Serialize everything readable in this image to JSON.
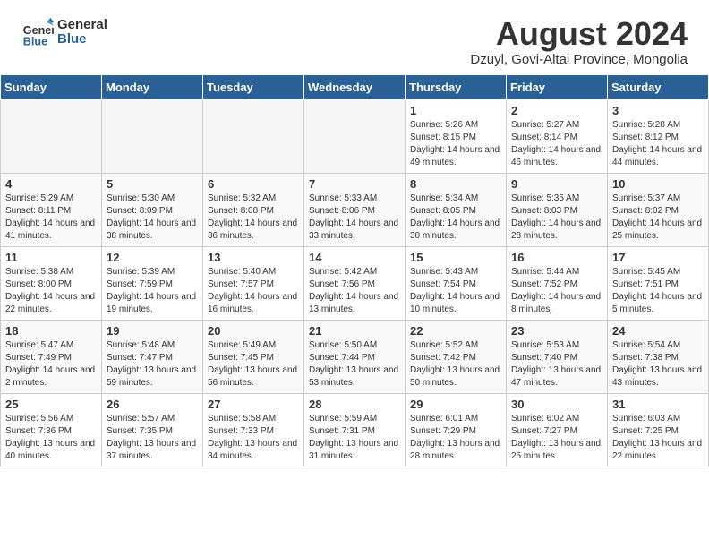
{
  "header": {
    "logo_line1": "General",
    "logo_line2": "Blue",
    "month_year": "August 2024",
    "location": "Dzuyl, Govi-Altai Province, Mongolia"
  },
  "calendar": {
    "days_of_week": [
      "Sunday",
      "Monday",
      "Tuesday",
      "Wednesday",
      "Thursday",
      "Friday",
      "Saturday"
    ],
    "weeks": [
      [
        {
          "day": "",
          "empty": true
        },
        {
          "day": "",
          "empty": true
        },
        {
          "day": "",
          "empty": true
        },
        {
          "day": "",
          "empty": true
        },
        {
          "day": "1",
          "sunrise": "5:26 AM",
          "sunset": "8:15 PM",
          "daylight": "14 hours and 49 minutes."
        },
        {
          "day": "2",
          "sunrise": "5:27 AM",
          "sunset": "8:14 PM",
          "daylight": "14 hours and 46 minutes."
        },
        {
          "day": "3",
          "sunrise": "5:28 AM",
          "sunset": "8:12 PM",
          "daylight": "14 hours and 44 minutes."
        }
      ],
      [
        {
          "day": "4",
          "sunrise": "5:29 AM",
          "sunset": "8:11 PM",
          "daylight": "14 hours and 41 minutes."
        },
        {
          "day": "5",
          "sunrise": "5:30 AM",
          "sunset": "8:09 PM",
          "daylight": "14 hours and 38 minutes."
        },
        {
          "day": "6",
          "sunrise": "5:32 AM",
          "sunset": "8:08 PM",
          "daylight": "14 hours and 36 minutes."
        },
        {
          "day": "7",
          "sunrise": "5:33 AM",
          "sunset": "8:06 PM",
          "daylight": "14 hours and 33 minutes."
        },
        {
          "day": "8",
          "sunrise": "5:34 AM",
          "sunset": "8:05 PM",
          "daylight": "14 hours and 30 minutes."
        },
        {
          "day": "9",
          "sunrise": "5:35 AM",
          "sunset": "8:03 PM",
          "daylight": "14 hours and 28 minutes."
        },
        {
          "day": "10",
          "sunrise": "5:37 AM",
          "sunset": "8:02 PM",
          "daylight": "14 hours and 25 minutes."
        }
      ],
      [
        {
          "day": "11",
          "sunrise": "5:38 AM",
          "sunset": "8:00 PM",
          "daylight": "14 hours and 22 minutes."
        },
        {
          "day": "12",
          "sunrise": "5:39 AM",
          "sunset": "7:59 PM",
          "daylight": "14 hours and 19 minutes."
        },
        {
          "day": "13",
          "sunrise": "5:40 AM",
          "sunset": "7:57 PM",
          "daylight": "14 hours and 16 minutes."
        },
        {
          "day": "14",
          "sunrise": "5:42 AM",
          "sunset": "7:56 PM",
          "daylight": "14 hours and 13 minutes."
        },
        {
          "day": "15",
          "sunrise": "5:43 AM",
          "sunset": "7:54 PM",
          "daylight": "14 hours and 10 minutes."
        },
        {
          "day": "16",
          "sunrise": "5:44 AM",
          "sunset": "7:52 PM",
          "daylight": "14 hours and 8 minutes."
        },
        {
          "day": "17",
          "sunrise": "5:45 AM",
          "sunset": "7:51 PM",
          "daylight": "14 hours and 5 minutes."
        }
      ],
      [
        {
          "day": "18",
          "sunrise": "5:47 AM",
          "sunset": "7:49 PM",
          "daylight": "14 hours and 2 minutes."
        },
        {
          "day": "19",
          "sunrise": "5:48 AM",
          "sunset": "7:47 PM",
          "daylight": "13 hours and 59 minutes."
        },
        {
          "day": "20",
          "sunrise": "5:49 AM",
          "sunset": "7:45 PM",
          "daylight": "13 hours and 56 minutes."
        },
        {
          "day": "21",
          "sunrise": "5:50 AM",
          "sunset": "7:44 PM",
          "daylight": "13 hours and 53 minutes."
        },
        {
          "day": "22",
          "sunrise": "5:52 AM",
          "sunset": "7:42 PM",
          "daylight": "13 hours and 50 minutes."
        },
        {
          "day": "23",
          "sunrise": "5:53 AM",
          "sunset": "7:40 PM",
          "daylight": "13 hours and 47 minutes."
        },
        {
          "day": "24",
          "sunrise": "5:54 AM",
          "sunset": "7:38 PM",
          "daylight": "13 hours and 43 minutes."
        }
      ],
      [
        {
          "day": "25",
          "sunrise": "5:56 AM",
          "sunset": "7:36 PM",
          "daylight": "13 hours and 40 minutes."
        },
        {
          "day": "26",
          "sunrise": "5:57 AM",
          "sunset": "7:35 PM",
          "daylight": "13 hours and 37 minutes."
        },
        {
          "day": "27",
          "sunrise": "5:58 AM",
          "sunset": "7:33 PM",
          "daylight": "13 hours and 34 minutes."
        },
        {
          "day": "28",
          "sunrise": "5:59 AM",
          "sunset": "7:31 PM",
          "daylight": "13 hours and 31 minutes."
        },
        {
          "day": "29",
          "sunrise": "6:01 AM",
          "sunset": "7:29 PM",
          "daylight": "13 hours and 28 minutes."
        },
        {
          "day": "30",
          "sunrise": "6:02 AM",
          "sunset": "7:27 PM",
          "daylight": "13 hours and 25 minutes."
        },
        {
          "day": "31",
          "sunrise": "6:03 AM",
          "sunset": "7:25 PM",
          "daylight": "13 hours and 22 minutes."
        }
      ]
    ]
  }
}
